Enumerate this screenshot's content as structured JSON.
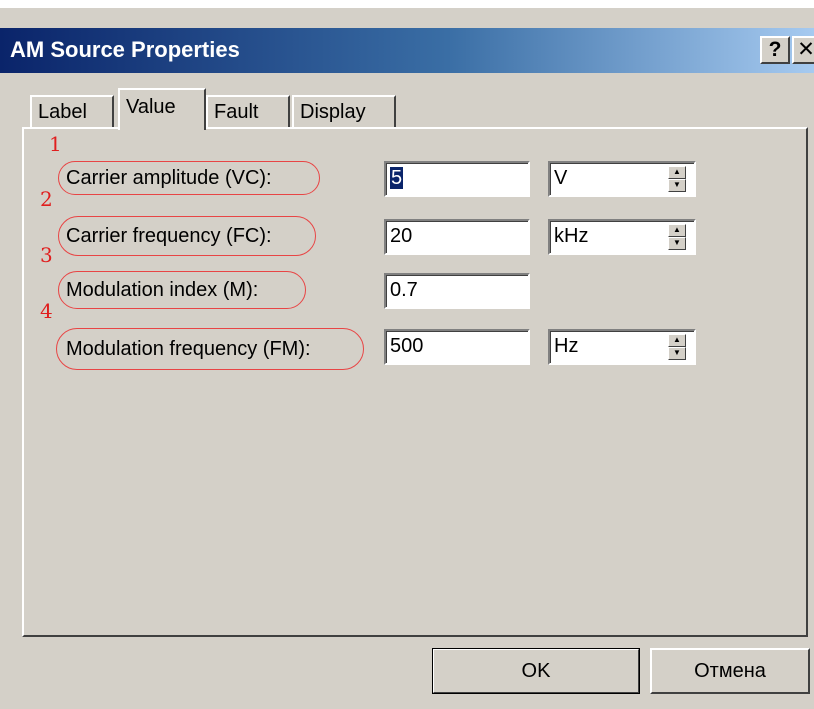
{
  "window": {
    "title": "AM Source Properties",
    "help_label": "?",
    "close_label": "✕"
  },
  "tabs": [
    {
      "label": "Label",
      "active": false
    },
    {
      "label": "Value",
      "active": true
    },
    {
      "label": "Fault",
      "active": false
    },
    {
      "label": "Display",
      "active": false
    }
  ],
  "fields": [
    {
      "marker": "1",
      "label": "Carrier amplitude (VC):",
      "value": "5",
      "unit": "V"
    },
    {
      "marker": "2",
      "label": "Carrier frequency (FC):",
      "value": "20",
      "unit": "kHz"
    },
    {
      "marker": "3",
      "label": "Modulation index (M):",
      "value": "0.7",
      "unit": ""
    },
    {
      "marker": "4",
      "label": "Modulation frequency (FM):",
      "value": "500",
      "unit": "Hz"
    }
  ],
  "buttons": {
    "ok": "OK",
    "cancel": "Отмена"
  },
  "colors": {
    "title_gradient_start": "#0a246a",
    "title_gradient_end": "#a6caf0",
    "annotation": "#e01e1e",
    "dialog_face": "#d4d0c8"
  },
  "icons": {
    "spin_up": "triangle-up",
    "spin_down": "triangle-down"
  }
}
